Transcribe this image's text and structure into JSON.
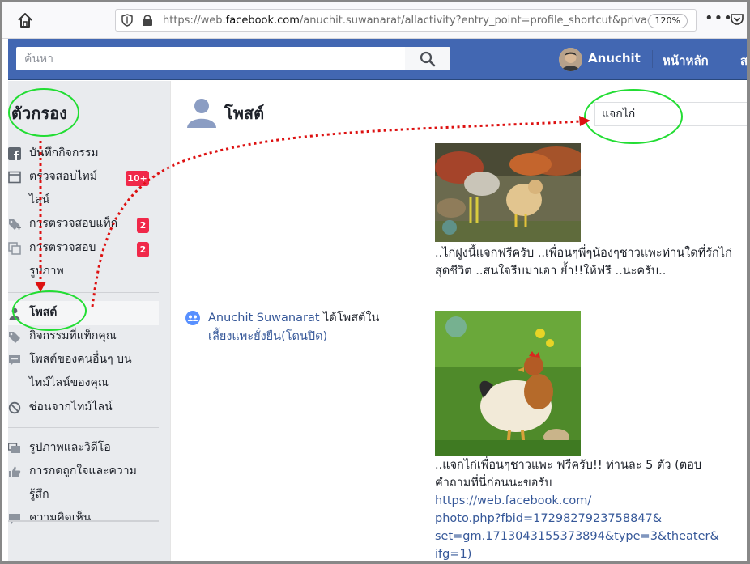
{
  "browser": {
    "url_prefix": "https://web.",
    "url_host": "facebook.com",
    "url_rest": "/anuchit.suwanarat/allactivity?entry_point=profile_shortcut&privacy_sou",
    "zoom": "120%",
    "more_label": "•••"
  },
  "header": {
    "search_placeholder": "ค้นหา",
    "username": "Anuchit",
    "home_label": "หน้าหลัก",
    "more_label": "ส"
  },
  "sidebar": {
    "title": "ตัวกรอง",
    "items": [
      {
        "label": "บันทึกกิจกรรม",
        "icon": "facebook-icon"
      },
      {
        "label": "ตรวจสอบไทม์ไลน์",
        "icon": "timeline-review-icon",
        "badge": "10+"
      },
      {
        "label": "การตรวจสอบแท็ก",
        "icon": "tag-review-icon",
        "badge": "2"
      },
      {
        "label": "การตรวจสอบรูปภาพ",
        "icon": "photo-review-icon",
        "badge": "2"
      },
      {
        "label": "โพสต์",
        "icon": "person-icon",
        "active": true
      },
      {
        "label": "กิจกรรมที่แท็กคุณ",
        "icon": "tag-icon"
      },
      {
        "label": "โพสต์ของคนอื่นๆ บนไทม์ไลน์ของคุณ",
        "icon": "comment-icon"
      },
      {
        "label": "ซ่อนจากไทม์ไลน์",
        "icon": "hidden-icon"
      },
      {
        "label": "รูปภาพและวิดีโอ",
        "icon": "photos-icon"
      },
      {
        "label": "การกดถูกใจและความรู้สึก",
        "icon": "like-icon"
      },
      {
        "label": "ความคิดเห็น",
        "icon": "comments-icon"
      }
    ]
  },
  "main": {
    "title": "โพสต์",
    "search_value": "แจกไก่",
    "posts": [
      {
        "text": "..ไก่ฝูงนี้แจกฟรีครับ ..เพื่อนๆพี่ๆน้องๆชาวแพะท่านใดที่รักไก่สุดชีวิต ..สนใจรีบมาเอา ย้ำ!!ให้ฟรี ..นะครับ.."
      },
      {
        "actor_name": "Anuchit Suwanarat",
        "actor_verb": " ได้โพสต์ใน",
        "group_name": "เลี้ยงแพะยั่งยืน(โดนปิด)",
        "text": "..แจกไก่เพื่อนๆชาวแพะ ฟรีครับ!! ท่านละ 5 ตัว (ตอบคำถามที่นี่ก่อนนะขอรับ",
        "link_lines": [
          "https://web.facebook.com/",
          "photo.php?fbid=1729827923758847&",
          "set=gm.1713043155373894&type=3&theater&",
          "ifg=1)"
        ]
      }
    ]
  },
  "colors": {
    "fb_blue": "#4267b2",
    "link": "#365899",
    "badge": "#f02849",
    "annotation_circle": "#22dd33",
    "annotation_arrow": "#dd1111"
  }
}
